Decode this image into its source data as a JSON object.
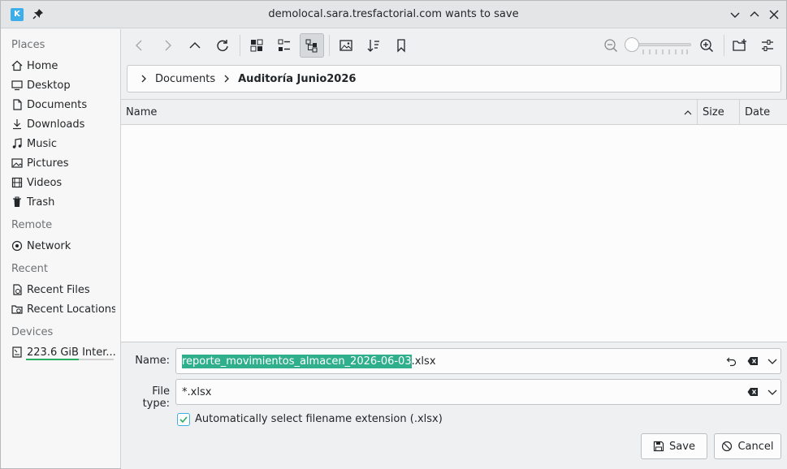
{
  "window": {
    "title": "demolocal.sara.tresfactorial.com wants to save",
    "app_icon_glyph": "K"
  },
  "sidebar": {
    "sections": [
      {
        "label": "Places"
      },
      {
        "label": "Remote"
      },
      {
        "label": "Recent"
      },
      {
        "label": "Devices"
      }
    ],
    "places": [
      {
        "label": "Home",
        "icon": "home-icon"
      },
      {
        "label": "Desktop",
        "icon": "desktop-icon"
      },
      {
        "label": "Documents",
        "icon": "documents-icon"
      },
      {
        "label": "Downloads",
        "icon": "downloads-icon"
      },
      {
        "label": "Music",
        "icon": "music-icon"
      },
      {
        "label": "Pictures",
        "icon": "pictures-icon"
      },
      {
        "label": "Videos",
        "icon": "videos-icon"
      },
      {
        "label": "Trash",
        "icon": "trash-icon"
      }
    ],
    "remote": [
      {
        "label": "Network",
        "icon": "network-icon"
      }
    ],
    "recent": [
      {
        "label": "Recent Files",
        "icon": "recent-files-icon"
      },
      {
        "label": "Recent Locations",
        "icon": "recent-locations-icon"
      }
    ],
    "devices": [
      {
        "label": "223.6 GiB Inter...",
        "icon": "drive-icon",
        "usage_fraction": 0.6
      }
    ]
  },
  "toolbar": {
    "zoom_fraction": 0.0
  },
  "breadcrumb": {
    "items": [
      "Documents",
      "Auditoría Junio2026"
    ]
  },
  "file_list": {
    "columns": [
      "Name",
      "Size",
      "Date"
    ]
  },
  "form": {
    "name_label": "Name:",
    "name_selected": "reporte_movimientos_almacen_2026-06-03",
    "name_extension": ".xlsx",
    "filetype_label": "File type:",
    "filetype_value": "*.xlsx",
    "auto_ext_label": "Automatically select filename extension (.xlsx)",
    "auto_ext_checked": true
  },
  "buttons": {
    "save": "Save",
    "cancel": "Cancel"
  },
  "colors": {
    "accent": "#3daee9",
    "selection": "#2faf8c",
    "usage": "#27ae60"
  }
}
